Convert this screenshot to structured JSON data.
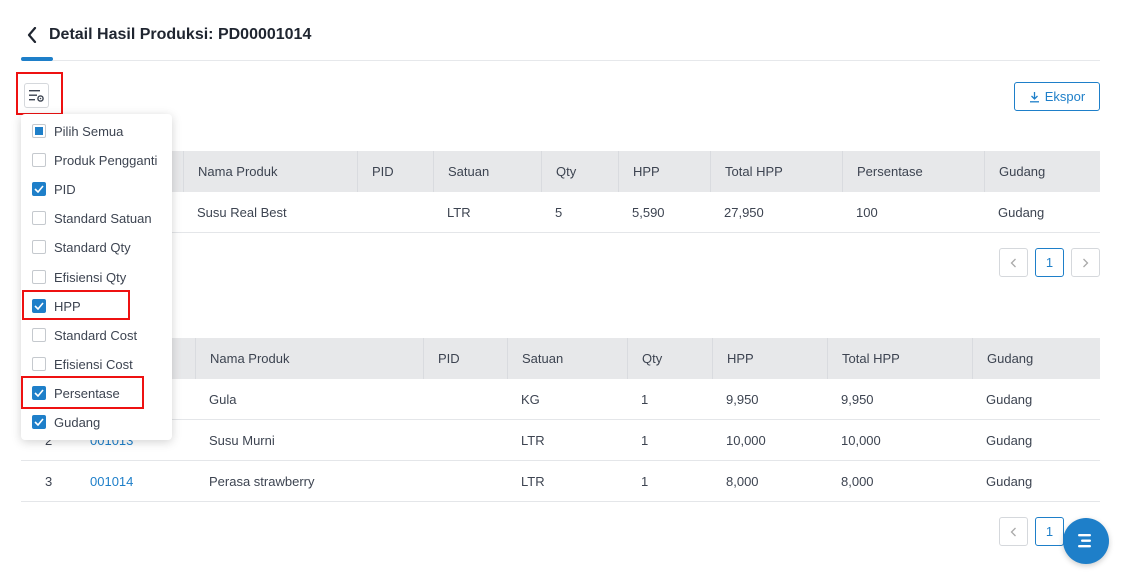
{
  "header": {
    "title": "Detail Hasil Produksi: PD00001014"
  },
  "toolbar": {
    "export_label": "Ekspor"
  },
  "column_menu": {
    "items": [
      {
        "label": "Pilih Semua",
        "state": "indeterminate"
      },
      {
        "label": "Produk Pengganti",
        "state": "unchecked"
      },
      {
        "label": "PID",
        "state": "checked"
      },
      {
        "label": "Standard Satuan",
        "state": "unchecked"
      },
      {
        "label": "Standard Qty",
        "state": "unchecked"
      },
      {
        "label": "Efisiensi Qty",
        "state": "unchecked"
      },
      {
        "label": "HPP",
        "state": "checked"
      },
      {
        "label": "Standard Cost",
        "state": "unchecked"
      },
      {
        "label": "Efisiensi Cost",
        "state": "unchecked"
      },
      {
        "label": "Persentase",
        "state": "checked"
      },
      {
        "label": "Gudang",
        "state": "checked"
      }
    ]
  },
  "table1": {
    "headers": [
      "Nama Produk",
      "PID",
      "Satuan",
      "Qty",
      "HPP",
      "Total HPP",
      "Persentase",
      "Gudang"
    ],
    "rows": [
      [
        "Susu Real Best",
        "",
        "LTR",
        "5",
        "5,590",
        "27,950",
        "100",
        "Gudang"
      ]
    ],
    "page": "1"
  },
  "table2": {
    "headers": [
      "Nama Produk",
      "PID",
      "Satuan",
      "Qty",
      "HPP",
      "Total HPP",
      "Gudang"
    ],
    "rows": [
      {
        "no": "",
        "code": "",
        "cells": [
          "Gula",
          "",
          "KG",
          "1",
          "9,950",
          "9,950",
          "Gudang"
        ]
      },
      {
        "no": "2",
        "code": "001013",
        "cells": [
          "Susu Murni",
          "",
          "LTR",
          "1",
          "10,000",
          "10,000",
          "Gudang"
        ]
      },
      {
        "no": "3",
        "code": "001014",
        "cells": [
          "Perasa strawberry",
          "",
          "LTR",
          "1",
          "8,000",
          "8,000",
          "Gudang"
        ]
      }
    ],
    "page": "1"
  },
  "colors": {
    "accent": "#1e7fc9",
    "highlight": "#ee1111",
    "header_bg": "#e7e8ea"
  }
}
